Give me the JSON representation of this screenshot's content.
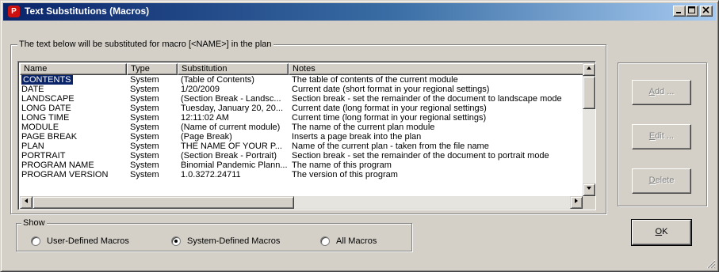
{
  "window": {
    "title": "Text Substitutions (Macros)",
    "app_icon_letter": "P",
    "buttons": [
      "minimize",
      "maximize",
      "close"
    ]
  },
  "macros_group": {
    "legend": "The text below will be substituted for macro [<NAME>] in the plan"
  },
  "listview": {
    "columns": [
      "Name",
      "Type",
      "Substitution",
      "Notes"
    ],
    "rows": [
      [
        "CONTENTS",
        "System",
        "(Table of Contents)",
        "The table of contents of the current module"
      ],
      [
        "DATE",
        "System",
        "1/20/2009",
        "Current date (short format in your regional settings)"
      ],
      [
        "LANDSCAPE",
        "System",
        "(Section Break - Landsc...",
        "Section break - set the remainder of the document to landscape mode"
      ],
      [
        "LONG DATE",
        "System",
        "Tuesday, January 20, 20...",
        "Current date (long format in your regional settings)"
      ],
      [
        "LONG TIME",
        "System",
        "12:11:02 AM",
        "Current time (long format in your regional settings)"
      ],
      [
        "MODULE",
        "System",
        "(Name of current module)",
        "The name of the current plan module"
      ],
      [
        "PAGE BREAK",
        "System",
        "(Page Break)",
        "Inserts a page break into the plan"
      ],
      [
        "PLAN",
        "System",
        "THE NAME OF YOUR P...",
        "Name of the current plan - taken from the file name"
      ],
      [
        "PORTRAIT",
        "System",
        "(Section Break - Portrait)",
        "Section break - set the remainder of the document to portrait mode"
      ],
      [
        "PROGRAM NAME",
        "System",
        "Binomial Pandemic Plann...",
        "The name of this program"
      ],
      [
        "PROGRAM VERSION",
        "System",
        "1.0.3272.24711",
        "The version of this program"
      ]
    ],
    "selected_row": 0
  },
  "show_group": {
    "legend": "Show",
    "options": [
      {
        "label": "User-Defined Macros",
        "checked": false
      },
      {
        "label": "System-Defined Macros",
        "checked": true
      },
      {
        "label": "All Macros",
        "checked": false
      }
    ]
  },
  "actions": {
    "add": {
      "prefix": "",
      "hotkey": "A",
      "suffix": "dd ...",
      "enabled": false
    },
    "edit": {
      "prefix": "",
      "hotkey": "E",
      "suffix": "dit ...",
      "enabled": false
    },
    "delete": {
      "prefix": "",
      "hotkey": "D",
      "suffix": "elete",
      "enabled": false
    },
    "ok": {
      "prefix": "",
      "hotkey": "O",
      "suffix": "K",
      "enabled": true
    }
  },
  "colors": {
    "title_gradient_start": "#0a246a",
    "title_gradient_end": "#a6caf0",
    "face": "#d4d0c8",
    "selection": "#0a246a"
  }
}
